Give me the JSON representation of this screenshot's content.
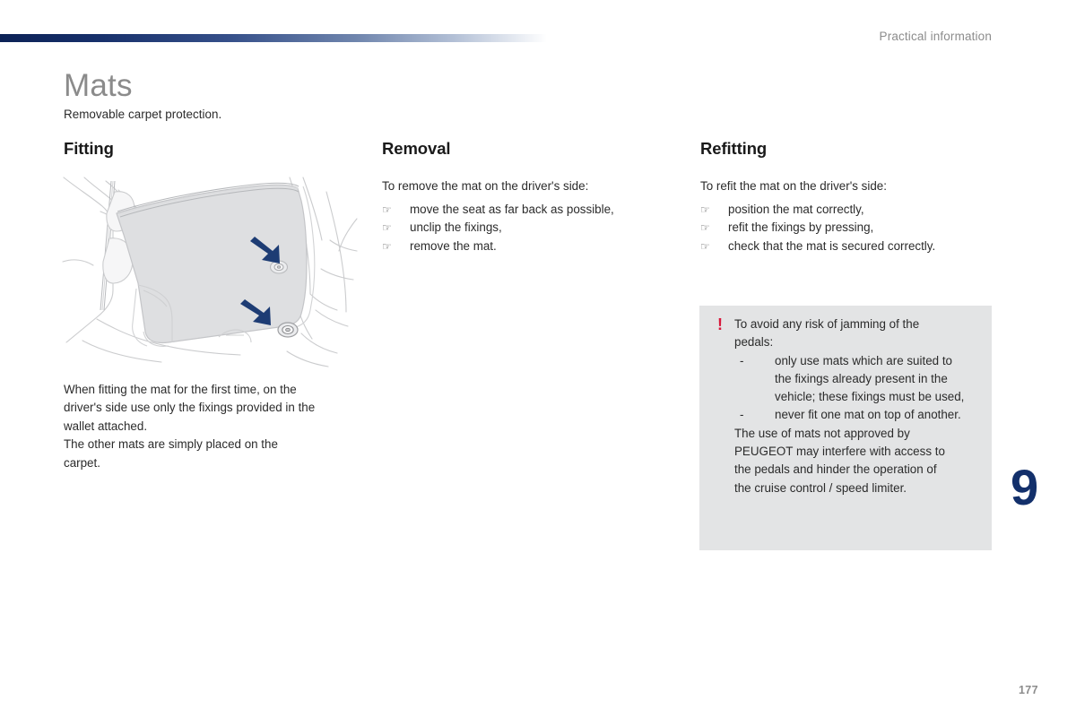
{
  "header": {
    "chapter_label": "Practical information",
    "bar_gradient_start": "#0c2256",
    "bar_gradient_end": "#ffffff"
  },
  "page": {
    "title": "Mats",
    "subtitle": "Removable carpet protection.",
    "title_color": "#8b8b8b",
    "folio": "177",
    "chapter_number": "9",
    "chapter_number_color": "#13306b"
  },
  "columns": {
    "fitting": {
      "heading": "Fitting",
      "note_line_1": "When fitting the mat for the first time, on the",
      "note_line_2": "driver's side use only the fixings provided in the",
      "note_line_3": "wallet attached.",
      "note_line_4": "The other mats are simply placed on the",
      "note_line_5": "carpet."
    },
    "removal": {
      "heading": "Removal",
      "intro": "To remove the mat on the driver's side:",
      "steps": [
        "move the seat as far back as possible,",
        "unclip the fixings,",
        "remove the mat."
      ]
    },
    "refitting": {
      "heading": "Refitting",
      "intro": "To refit the mat on the driver's side:",
      "steps": [
        "position the mat correctly,",
        "refit the fixings by pressing,",
        "check that the mat is secured correctly."
      ]
    }
  },
  "warning": {
    "icon": "exclamation-mark",
    "icon_glyph": "!",
    "icon_color": "#d8193c",
    "background_color": "#e3e4e5",
    "intro_line_1": "To avoid any risk of jamming of the",
    "intro_line_2": "pedals:",
    "bullets": [
      {
        "dash": "-",
        "line_1": "only use mats which are suited to",
        "line_2": "the fixings already present in the",
        "line_3": "vehicle; these fixings must be used,"
      },
      {
        "dash": "-",
        "line_1": "never fit one mat on top of another.",
        "line_2": "",
        "line_3": ""
      }
    ],
    "outro_line_1": "The use of mats not approved by",
    "outro_line_2": "PEUGEOT may interfere with access to",
    "outro_line_3": "the pedals and hinder the operation of",
    "outro_line_4": "the cruise control / speed limiter."
  },
  "illustration": {
    "caption": "car-floor-mat-fixings-diagram",
    "mat_fill": "#dddee0",
    "outline_color": "#c9cacd",
    "arrow_color": "#1d3c74",
    "arrow_count": "2"
  },
  "icons": {
    "hand_bullet": "☞"
  }
}
